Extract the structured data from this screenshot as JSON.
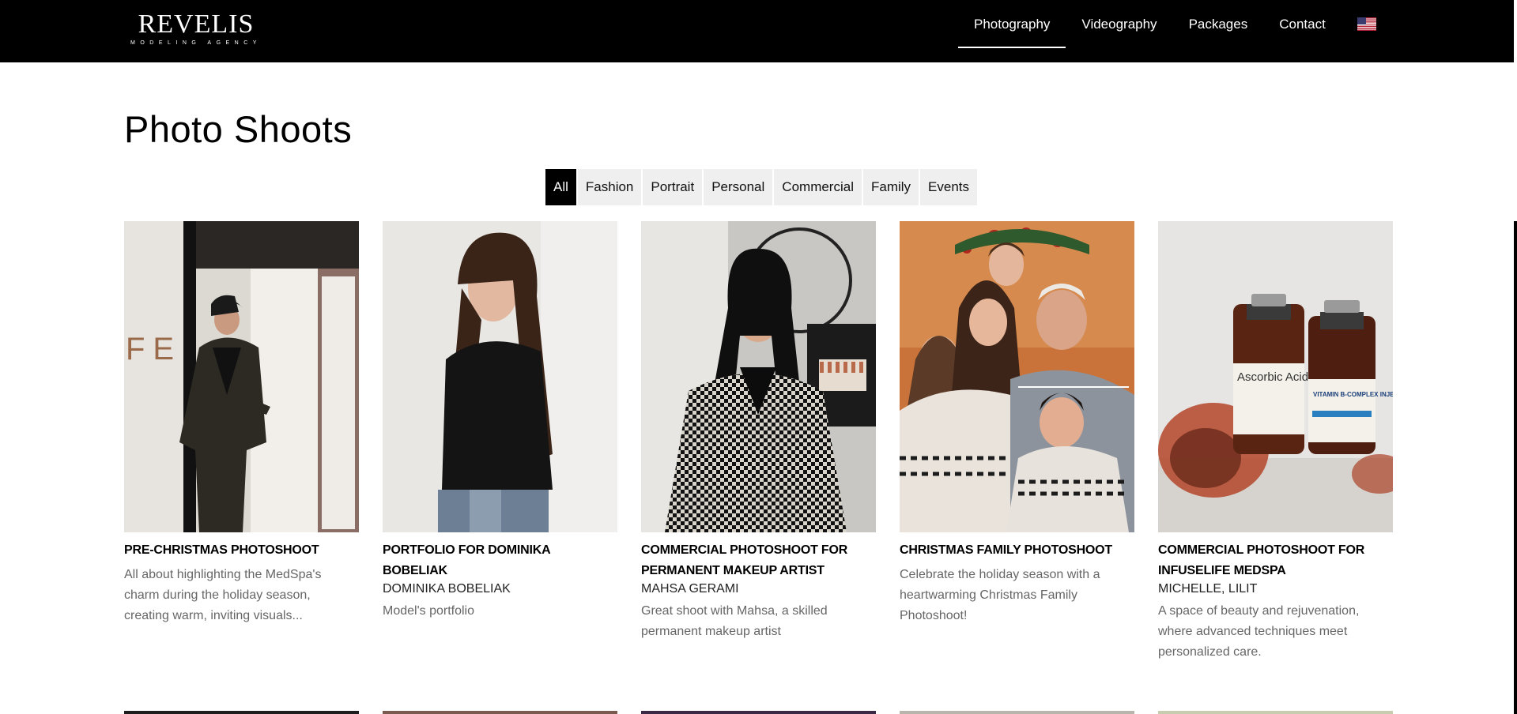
{
  "header": {
    "logo_main": "REVELIS",
    "logo_sub": "MODELING AGENCY",
    "nav": [
      "Photography",
      "Videography",
      "Packages",
      "Contact"
    ]
  },
  "page": {
    "title": "Photo Shoots"
  },
  "filters": [
    "All",
    "Fashion",
    "Portrait",
    "Personal",
    "Commercial",
    "Family",
    "Events"
  ],
  "cards": [
    {
      "title": "PRE-CHRISTMAS PHOTOSHOOT",
      "client": "",
      "description": "All about highlighting the MedSpa's charm during the holiday season, creating warm, inviting visuals..."
    },
    {
      "title": "PORTFOLIO FOR DOMINIKA BOBELIAK",
      "client": "DOMINIKA BOBELIAK",
      "description": "Model's portfolio"
    },
    {
      "title": "COMMERCIAL PHOTOSHOOT FOR PERMANENT MAKEUP ARTIST",
      "client": "MAHSA GERAMI",
      "description": "Great shoot with Mahsa, a skilled permanent makeup artist"
    },
    {
      "title": "CHRISTMAS FAMILY PHOTOSHOOT",
      "client": "",
      "description": "Celebrate the holiday season with a heartwarming Christmas Family Photoshoot!"
    },
    {
      "title": "COMMERCIAL PHOTOSHOOT FOR INFUSELIFE MEDSPA",
      "client": "MICHELLE, LILIT",
      "description": "A space of beauty and rejuvenation, where advanced techniques meet personalized care."
    }
  ],
  "image_text": {
    "storefront_letters": "FE",
    "vial_1": "Ascorbic Acid Injection",
    "vial_2": "VITAMIN B-COMPLEX INJECTION"
  },
  "colors": {
    "header_bg": "#000000",
    "filter_bg": "#efefef",
    "filter_active_bg": "#000000",
    "desc_text": "#666666"
  }
}
